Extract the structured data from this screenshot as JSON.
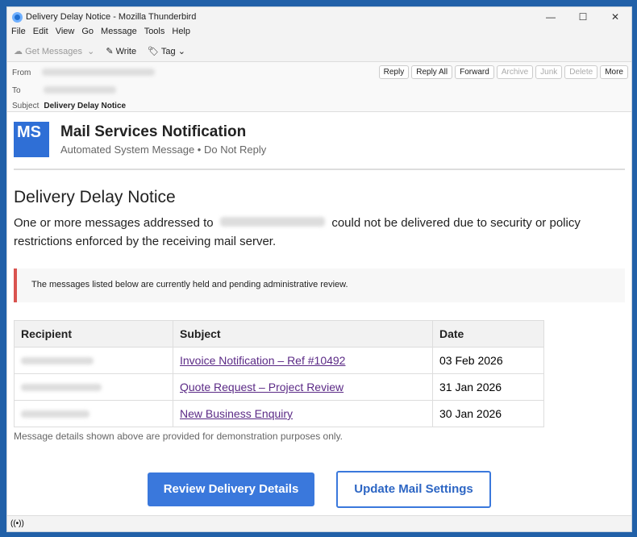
{
  "window": {
    "title": "Delivery Delay Notice - Mozilla Thunderbird"
  },
  "menu": [
    "File",
    "Edit",
    "View",
    "Go",
    "Message",
    "Tools",
    "Help"
  ],
  "toolbar": {
    "get_messages": "Get Messages",
    "write": "Write",
    "tag": "Tag"
  },
  "header": {
    "from_label": "From",
    "to_label": "To",
    "subject_label": "Subject",
    "subject": "Delivery Delay Notice",
    "actions": [
      "Reply",
      "Reply All",
      "Forward",
      "Archive",
      "Junk",
      "Delete",
      "More"
    ]
  },
  "email": {
    "logo": "MS",
    "sender_title": "Mail Services Notification",
    "sender_sub": "Automated System Message • Do Not Reply",
    "heading": "Delivery Delay Notice",
    "para_a": "One or more messages addressed to",
    "para_b": "could not be delivered due to security or policy restrictions enforced by the receiving mail server.",
    "note": "The messages listed below are currently held and pending administrative review.",
    "columns": [
      "Recipient",
      "Subject",
      "Date"
    ],
    "rows": [
      {
        "subject": "Invoice Notification – Ref #10492",
        "date": "03 Feb 2026"
      },
      {
        "subject": "Quote Request – Project Review",
        "date": "31 Jan 2026"
      },
      {
        "subject": "New Business Enquiry",
        "date": "30 Jan 2026"
      }
    ],
    "footnote": "Message details shown above are provided for demonstration purposes only.",
    "btn_primary": "Review Delivery Details",
    "btn_secondary": "Update Mail Settings"
  }
}
